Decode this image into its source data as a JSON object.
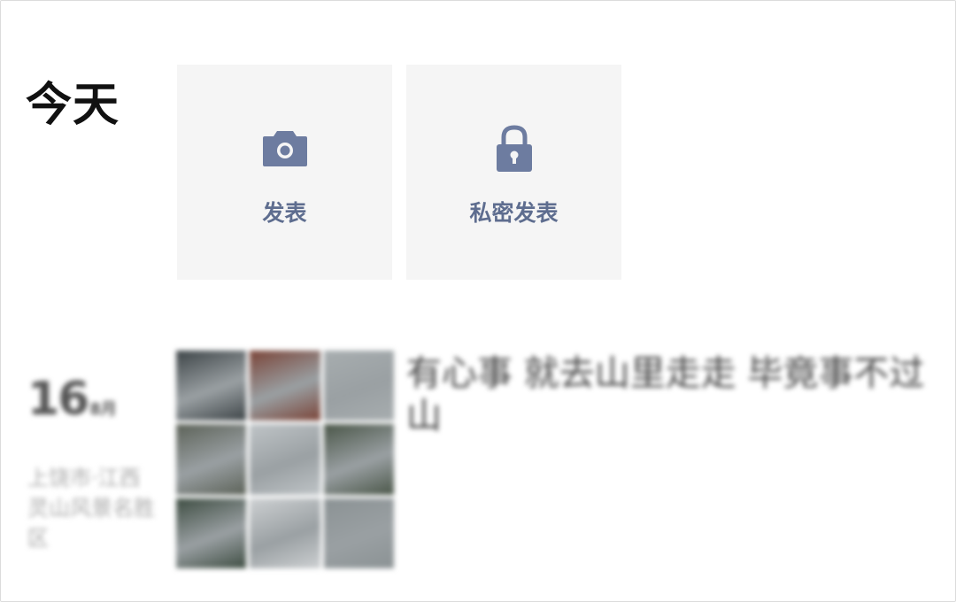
{
  "today": {
    "label": "今天"
  },
  "actions": [
    {
      "label": "发表",
      "icon": "camera-icon"
    },
    {
      "label": "私密发表",
      "icon": "lock-icon"
    }
  ],
  "colors": {
    "tile_background": "#f5f5f5",
    "action_accent": "#6d7ca0",
    "action_label": "#5e6d8f"
  },
  "post": {
    "day": "16",
    "month": "8月",
    "location": "上饶市·江西灵山风景名胜区",
    "text": "有心事 就去山里走走 毕竟事不过山",
    "photo_count": 9,
    "photo_colors": [
      "#3d4447",
      "#7a4438",
      "#a7adaf",
      "#5c6258",
      "#bfc4c7",
      "#4a5648",
      "#3e4d42",
      "#cdd0d2",
      "#8b9294"
    ]
  }
}
